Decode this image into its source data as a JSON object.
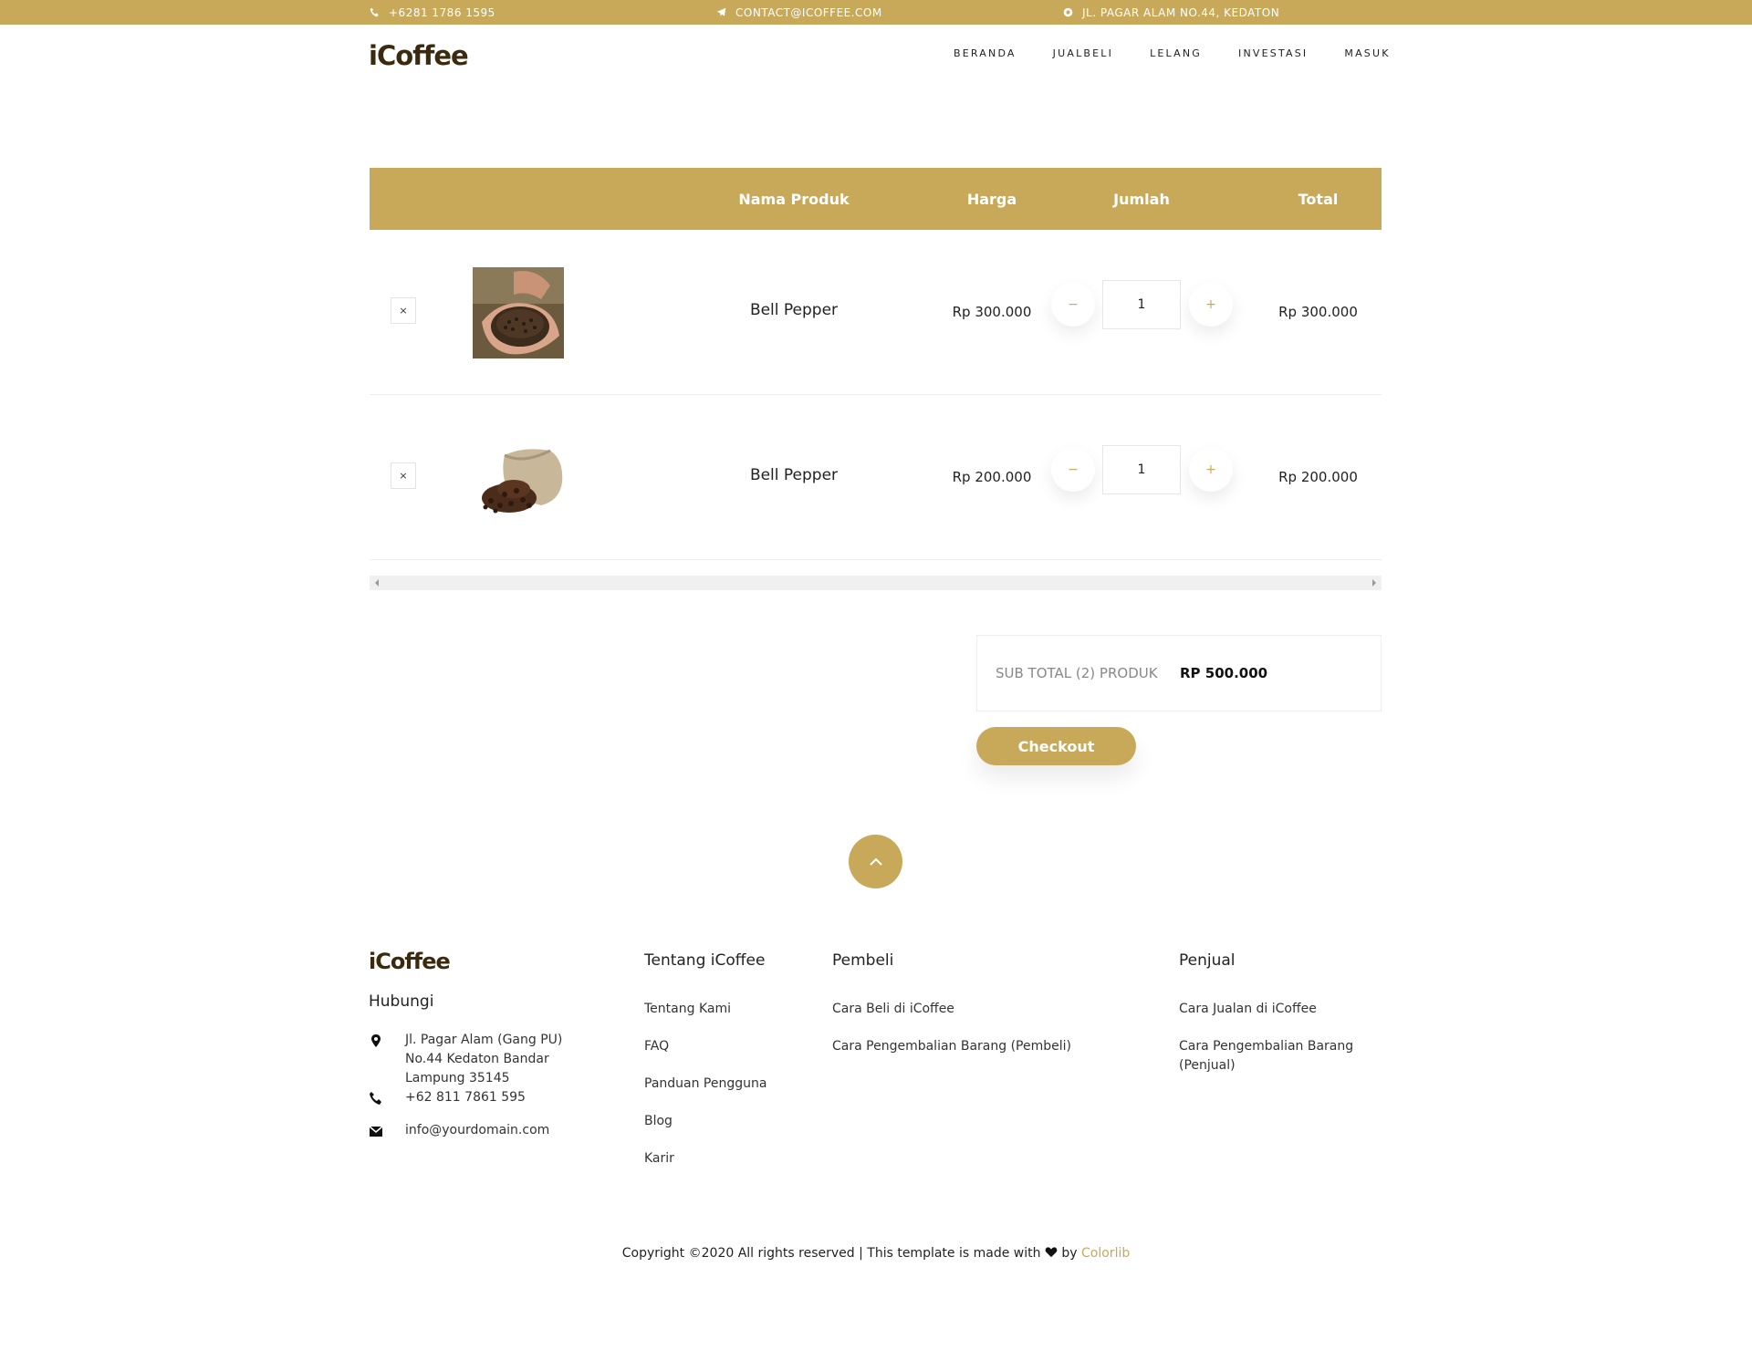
{
  "topbar": {
    "phone": "+6281 1786 1595",
    "email": "CONTACT@ICOFFEE.COM",
    "address": "JL. PAGAR ALAM NO.44, KEDATON"
  },
  "header": {
    "logo": "iCoffee",
    "nav": [
      "BERANDA",
      "JUALBELI",
      "LELANG",
      "INVESTASI",
      "MASUK"
    ]
  },
  "cart": {
    "columns": {
      "name": "Nama Produk",
      "price": "Harga",
      "qty": "Jumlah",
      "total": "Total"
    },
    "items": [
      {
        "remove": "×",
        "name": "Bell Pepper",
        "price": "Rp 300.000",
        "qty": "1",
        "total": "Rp 300.000",
        "minus": "−",
        "plus": "+"
      },
      {
        "remove": "×",
        "name": "Bell Pepper",
        "price": "Rp 200.000",
        "qty": "1",
        "total": "Rp 200.000",
        "minus": "−",
        "plus": "+"
      }
    ],
    "subtotal_label": "SUB TOTAL (2) PRODUK",
    "subtotal_value": "RP 500.000",
    "checkout_label": "Checkout"
  },
  "footer": {
    "logo": "iCoffee",
    "contact_title": "Hubungi",
    "address": [
      "Jl. Pagar Alam (Gang PU)",
      "No.44 Kedaton Bandar",
      "Lampung 35145"
    ],
    "phone": "+62 811 7861 595",
    "email": "info@yourdomain.com",
    "about_title": "Tentang iCoffee",
    "about_links": [
      "Tentang Kami",
      "FAQ",
      "Panduan Pengguna",
      "Blog",
      "Karir"
    ],
    "buyer_title": "Pembeli",
    "buyer_links": [
      "Cara Beli di iCoffee",
      "Cara Pengembalian Barang (Pembeli)"
    ],
    "seller_title": "Penjual",
    "seller_links": [
      "Cara Jualan di iCoffee",
      "Cara Pengembalian Barang",
      "(Penjual)"
    ],
    "copyright_pre": "Copyright ©2020 All rights reserved | This template is made with",
    "copyright_by": "by",
    "copyright_brand": "Colorlib"
  },
  "colors": {
    "accent": "#c8a95a",
    "logo": "#3b2a0e"
  }
}
